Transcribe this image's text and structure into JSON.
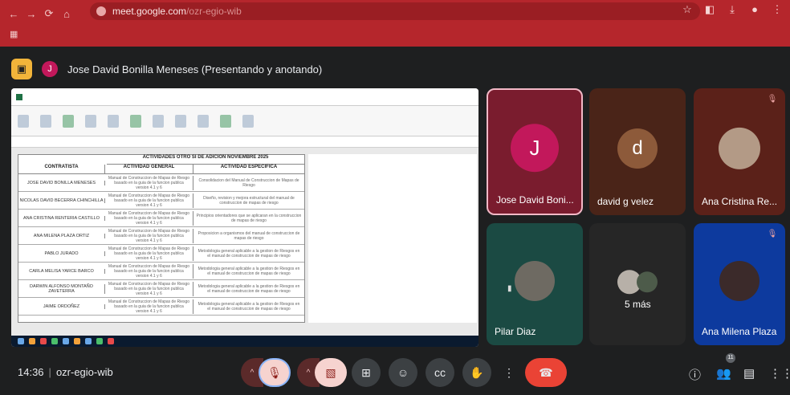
{
  "browser": {
    "url_host": "meet.google.com",
    "url_path": "/ozr-egio-wib"
  },
  "presenter": {
    "initial": "J",
    "label": "Jose David Bonilla Meneses (Presentando y anotando)"
  },
  "shared_sheet": {
    "title": "ACTIVIDADES OTRO SI DE ADICION NOVIEMBRE 2025",
    "headers": [
      "CONTRATISTA",
      "ACTIVIDAD GENERAL",
      "ACTIVIDAD ESPECIFICA"
    ],
    "rows": [
      {
        "name": "JOSE DAVID BONILLA MENESES",
        "general": "Manual de Construccion de Mapas de Riesgo basado en la guia de la funcion publica version 4.1 y 6",
        "specific": "Consolidacion del Manual de Construccion de Mapas de Riesgo"
      },
      {
        "name": "NICOLAS DAVID BECERRA CHINCHILLA",
        "general": "Manual de Construccion de Mapas de Riesgo basado en la guia de la funcion publica version 4.1 y 6",
        "specific": "Diseño, revision y mejora estructural del manual de construccion de mapas de riesgo"
      },
      {
        "name": "ANA CRISTINA RENTERIA CASTILLO",
        "general": "Manual de Construccion de Mapas de Riesgo basado en la guia de la funcion publica version 4.1 y 6",
        "specific": "Principios orientadores que se aplicaran en la construccion de mapas de riesgo"
      },
      {
        "name": "ANA MILENA PLAZA ORTIZ",
        "general": "Manual de Construccion de Mapas de Riesgo basado en la guia de la funcion publica version 4.1 y 6",
        "specific": "Proposicion a organismos del manual de construccion de mapas de riesgo"
      },
      {
        "name": "PABLO JURADO",
        "general": "Manual de Construccion de Mapas de Riesgo basado en la guia de la funcion publica version 4.1 y 6",
        "specific": "Metodologia general aplicable a la gestion de Riesgos en el manual de construccion de mapas de riesgo"
      },
      {
        "name": "CARLA MELISA YARCE BARCO",
        "general": "Manual de Construccion de Mapas de Riesgo basado en la guia de la funcion publica version 4.1 y 6",
        "specific": "Metodologia general aplicable a la gestion de Riesgos en el manual de construccion de mapas de riesgo"
      },
      {
        "name": "DARWIN ALFONSO MONTAÑO ZAVETERRA",
        "general": "Manual de Construccion de Mapas de Riesgo basado en la guia de la funcion publica version 4.1 y 6",
        "specific": "Metodologia general aplicable a la gestion de Riesgos en el manual de construccion de mapas de riesgo"
      },
      {
        "name": "JAIME ORDOÑEZ",
        "general": "Manual de Construccion de Mapas de Riesgo basado en la guia de la funcion publica version 4.1 y 6",
        "specific": "Metodologia general aplicable a la gestion de Riesgos en el manual de construccion de mapas de riesgo"
      }
    ]
  },
  "participants": [
    {
      "name": "Jose David Boni...",
      "initial": "J",
      "color": "#c2185b"
    },
    {
      "name": "david g velez",
      "initial": "d",
      "color": "#8d5a3a"
    },
    {
      "name": "Ana Cristina Re...",
      "initial": "",
      "color": "#6d2b24"
    },
    {
      "name": "Pilar Diaz",
      "initial": "",
      "color": "#1b4a43"
    },
    {
      "name": "5 más",
      "initial": "",
      "color": "#2c2c2c"
    },
    {
      "name": "Ana Milena Plaza",
      "initial": "",
      "color": "#0d3a9e"
    }
  ],
  "meeting": {
    "time": "14:36",
    "code": "ozr-egio-wib",
    "participant_count": "11"
  }
}
